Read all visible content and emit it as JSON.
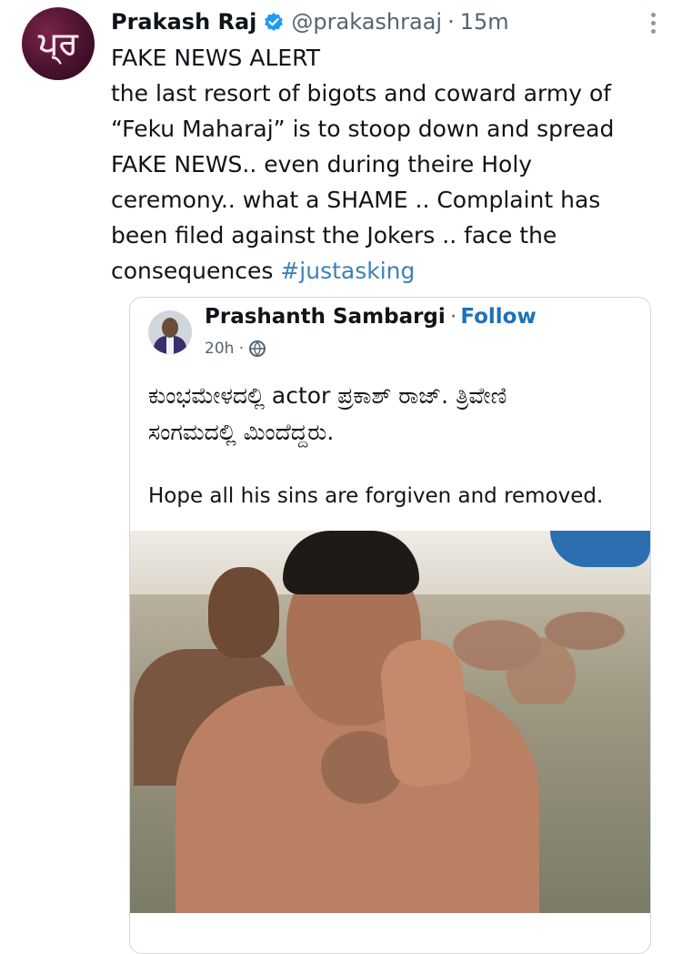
{
  "author": {
    "name": "Prakash Raj",
    "handle": "@prakashraaj",
    "separator": "·",
    "time": "15m",
    "avatar_text": "ਪ੍ਰ"
  },
  "tweet": {
    "lines": [
      "FAKE NEWS ALERT",
      "the last resort of bigots and coward army of",
      "“Feku Maharaj” is to stoop down and spread",
      "FAKE NEWS.. even during theire Holy",
      "ceremony.. what a SHAME .. Complaint has",
      "been filed against the Jokers .. face the"
    ],
    "last_line_prefix": "consequences ",
    "hashtag": "#justasking"
  },
  "quoted": {
    "name": "Prashanth Sambargi",
    "separator": "·",
    "follow": "Follow",
    "time": "20h ·",
    "kannada_line1": "ಕುಂಭಮೇಳದಲ್ಲಿ actor  ಪ್ರಕಾಶ್ ರಾಜ್. ತ್ರಿವೇಣಿ",
    "kannada_line2": "ಸಂಗಮದಲ್ಲಿ ಮಿಂದೆದ್ದರು.",
    "english": "Hope all his sins are forgiven and removed."
  },
  "colors": {
    "link": "#1d72b8",
    "hashtag": "#3b82b8",
    "verified": "#1d9bf0",
    "secondary_text": "#536471"
  },
  "icons": {
    "verified": "verified-badge-icon",
    "more": "more-options-icon",
    "globe": "globe-icon"
  }
}
